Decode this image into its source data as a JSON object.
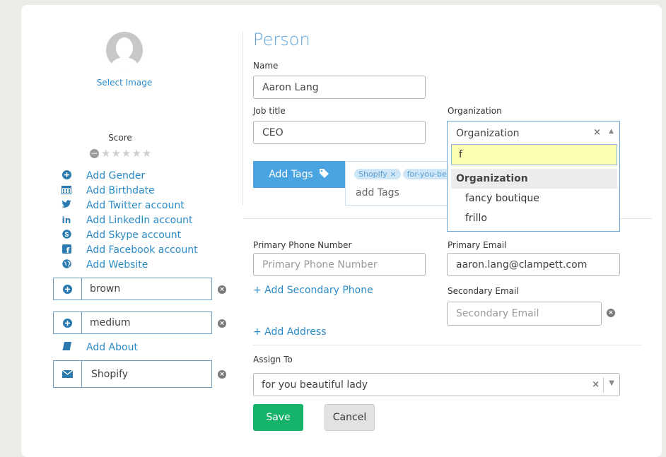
{
  "profile": {
    "select_image": "Select Image",
    "score_label": "Score",
    "rating_stars": 0,
    "add_links": [
      {
        "label": "Add Gender",
        "icon": "plus-circle-icon"
      },
      {
        "label": "Add Birthdate",
        "icon": "calendar-icon"
      },
      {
        "label": "Add Twitter account",
        "icon": "twitter-icon"
      },
      {
        "label": "Add LinkedIn account",
        "icon": "linkedin-icon"
      },
      {
        "label": "Add Skype account",
        "icon": "skype-icon"
      },
      {
        "label": "Add Facebook account",
        "icon": "facebook-icon"
      },
      {
        "label": "Add Website",
        "icon": "globe-icon"
      }
    ],
    "fields": [
      {
        "value": "brown",
        "icon": "plus-circle-icon"
      },
      {
        "value": "medium",
        "icon": "plus-circle-icon"
      }
    ],
    "add_about": "Add About",
    "source_field": {
      "value": "Shopify",
      "icon": "envelope-icon"
    }
  },
  "form": {
    "title": "Person",
    "name_label": "Name",
    "name_value": "Aaron Lang",
    "job_title_label": "Job title",
    "job_title_value": "CEO",
    "organization_label": "Organization",
    "organization_value": "Organization",
    "add_tags_label": "Add Tags",
    "tags": [
      "Shopify",
      "for-you-be"
    ],
    "tags_placeholder": "add Tags",
    "primary_phone_label": "Primary Phone Number",
    "primary_phone_placeholder": "Primary Phone Number",
    "add_secondary_phone": "+ Add Secondary Phone",
    "add_address": "+ Add Address",
    "primary_email_label": "Primary Email",
    "primary_email_value": "aaron.lang@clampett.com",
    "secondary_email_label": "Secondary Email",
    "secondary_email_placeholder": "Secondary Email",
    "assign_to_label": "Assign To",
    "assign_to_value": "for you beautiful lady",
    "save_label": "Save",
    "cancel_label": "Cancel"
  },
  "org_dropdown": {
    "search_value": "f",
    "group_label": "Organization",
    "options": [
      "fancy boutique",
      "frillo"
    ]
  },
  "colors": {
    "accent": "#4aa4e2",
    "link": "#2a8ac6",
    "save": "#15b26a",
    "search_highlight": "#fbfdb0"
  }
}
